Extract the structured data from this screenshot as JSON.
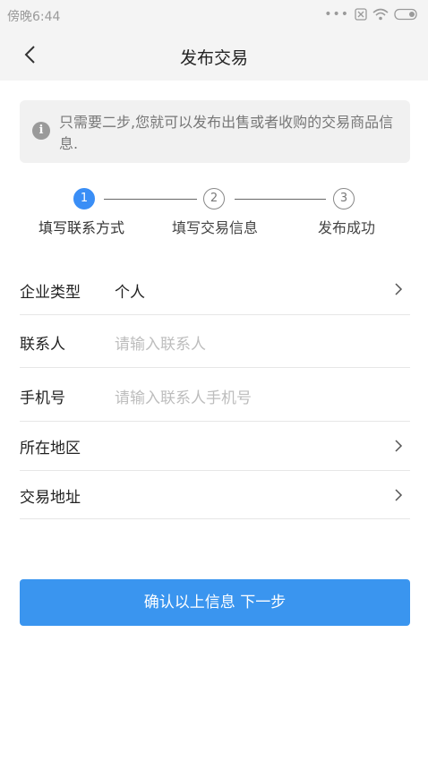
{
  "status_bar": {
    "time": "傍晚6:44"
  },
  "nav": {
    "title": "发布交易",
    "back_icon": "chevron-left-icon"
  },
  "notice": {
    "text": "只需要二步,您就可以发布出售或者收购的交易商品信息.",
    "icon": "info-icon"
  },
  "steps": [
    {
      "number": "1",
      "label": "填写联系方式",
      "active": true
    },
    {
      "number": "2",
      "label": "填写交易信息",
      "active": false
    },
    {
      "number": "3",
      "label": "发布成功",
      "active": false
    }
  ],
  "form": {
    "company_type": {
      "label": "企业类型",
      "value": "个人"
    },
    "contact": {
      "label": "联系人",
      "placeholder": "请输入联系人"
    },
    "phone": {
      "label": "手机号",
      "placeholder": "请输入联系人手机号"
    },
    "region": {
      "label": "所在地区"
    },
    "address": {
      "label": "交易地址"
    }
  },
  "confirm_button": {
    "label": "确认以上信息 下一步"
  },
  "colors": {
    "accent": "#3a95ef",
    "step_active": "#3a8ef6",
    "placeholder": "#bdbdbd"
  }
}
